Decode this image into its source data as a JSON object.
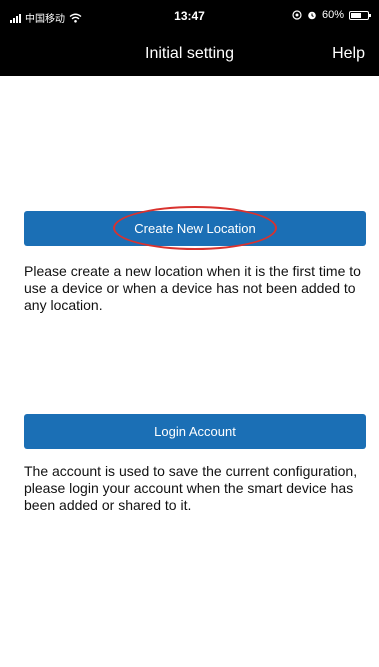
{
  "status_bar": {
    "carrier": "中国移动",
    "time": "13:47",
    "battery": "60%",
    "battery_level": 0.6,
    "icons": [
      "signal-icon",
      "wifi-icon",
      "location-icon",
      "alarm-icon",
      "battery-icon"
    ]
  },
  "nav": {
    "title": "Initial setting",
    "help_label": "Help"
  },
  "main": {
    "create_button_label": "Create New Location",
    "create_description": "Please create a new location when it is the first time to use a device or when a device has not been added to any location.",
    "login_button_label": "Login Account",
    "login_description": "The account is used to save the current configuration, please login your account when the smart device has been added or shared to it."
  },
  "colors": {
    "bar_background": "#000000",
    "button_blue": "#1b6fb5",
    "highlight_red": "#d9322e"
  }
}
